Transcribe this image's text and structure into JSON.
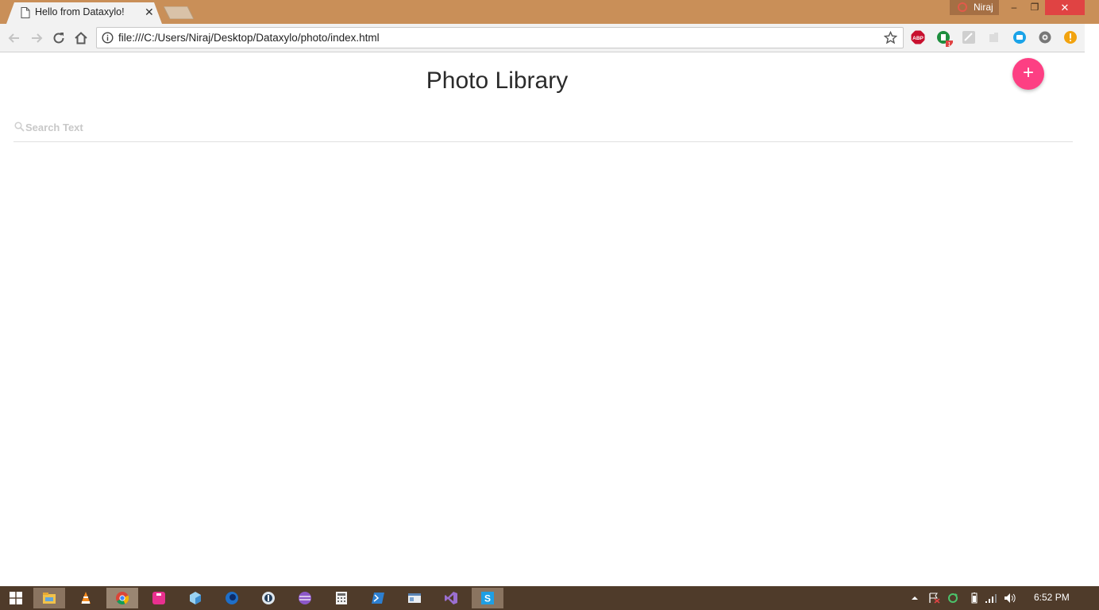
{
  "browser": {
    "tab": {
      "title": "Hello from Dataxylo!",
      "close_glyph": "✕"
    },
    "profile_name": "Niraj",
    "window_controls": {
      "minimize": "‒",
      "restore": "❐",
      "close": "✕"
    },
    "address_bar": {
      "url": "file:///C:/Users/Niraj/Desktop/Dataxylo/photo/index.html"
    },
    "extensions": [
      {
        "name": "adblock-plus-icon",
        "color": "#c8102e",
        "label": "ABP"
      },
      {
        "name": "extension-green-icon",
        "color": "#1e8e3e",
        "badge": "1"
      },
      {
        "name": "extension-image-icon",
        "color": "#bdbdbd"
      },
      {
        "name": "extension-puzzle-icon",
        "color": "#d6d6d6"
      },
      {
        "name": "extension-blue-icon",
        "color": "#1aa3e8"
      },
      {
        "name": "extension-gear-icon",
        "color": "#6f6f6f"
      },
      {
        "name": "extension-warning-icon",
        "color": "#f2a30f"
      }
    ]
  },
  "page": {
    "title": "Photo Library",
    "add_button_label": "+",
    "search": {
      "placeholder": "Search Text",
      "value": ""
    }
  },
  "taskbar": {
    "clock": "6:52 PM",
    "items": [
      "start-icon",
      "file-explorer-icon",
      "vlc-icon",
      "chrome-icon",
      "app-pink-icon",
      "app-box-icon",
      "app-blue-circle-icon",
      "app-dark-circle-icon",
      "app-purple-icon",
      "calculator-icon",
      "powershell-icon",
      "app-window-icon",
      "visual-studio-icon",
      "skype-icon"
    ]
  },
  "colors": {
    "titlebar": "#c98f58",
    "accent_fab": "#fd3f83",
    "taskbar": "#4f3b2a"
  }
}
